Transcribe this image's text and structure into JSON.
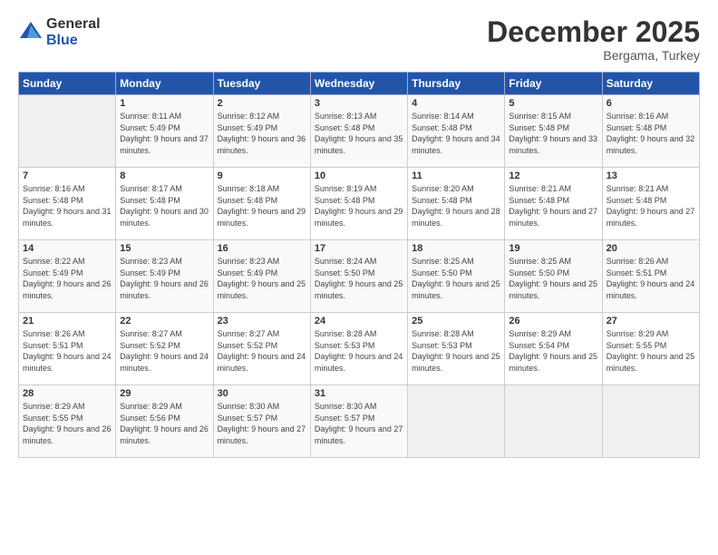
{
  "logo": {
    "general": "General",
    "blue": "Blue"
  },
  "title": "December 2025",
  "subtitle": "Bergama, Turkey",
  "days_header": [
    "Sunday",
    "Monday",
    "Tuesday",
    "Wednesday",
    "Thursday",
    "Friday",
    "Saturday"
  ],
  "weeks": [
    [
      {
        "num": "",
        "empty": true
      },
      {
        "num": "1",
        "sunrise": "Sunrise: 8:11 AM",
        "sunset": "Sunset: 5:49 PM",
        "daylight": "Daylight: 9 hours and 37 minutes."
      },
      {
        "num": "2",
        "sunrise": "Sunrise: 8:12 AM",
        "sunset": "Sunset: 5:49 PM",
        "daylight": "Daylight: 9 hours and 36 minutes."
      },
      {
        "num": "3",
        "sunrise": "Sunrise: 8:13 AM",
        "sunset": "Sunset: 5:48 PM",
        "daylight": "Daylight: 9 hours and 35 minutes."
      },
      {
        "num": "4",
        "sunrise": "Sunrise: 8:14 AM",
        "sunset": "Sunset: 5:48 PM",
        "daylight": "Daylight: 9 hours and 34 minutes."
      },
      {
        "num": "5",
        "sunrise": "Sunrise: 8:15 AM",
        "sunset": "Sunset: 5:48 PM",
        "daylight": "Daylight: 9 hours and 33 minutes."
      },
      {
        "num": "6",
        "sunrise": "Sunrise: 8:16 AM",
        "sunset": "Sunset: 5:48 PM",
        "daylight": "Daylight: 9 hours and 32 minutes."
      }
    ],
    [
      {
        "num": "7",
        "sunrise": "Sunrise: 8:16 AM",
        "sunset": "Sunset: 5:48 PM",
        "daylight": "Daylight: 9 hours and 31 minutes."
      },
      {
        "num": "8",
        "sunrise": "Sunrise: 8:17 AM",
        "sunset": "Sunset: 5:48 PM",
        "daylight": "Daylight: 9 hours and 30 minutes."
      },
      {
        "num": "9",
        "sunrise": "Sunrise: 8:18 AM",
        "sunset": "Sunset: 5:48 PM",
        "daylight": "Daylight: 9 hours and 29 minutes."
      },
      {
        "num": "10",
        "sunrise": "Sunrise: 8:19 AM",
        "sunset": "Sunset: 5:48 PM",
        "daylight": "Daylight: 9 hours and 29 minutes."
      },
      {
        "num": "11",
        "sunrise": "Sunrise: 8:20 AM",
        "sunset": "Sunset: 5:48 PM",
        "daylight": "Daylight: 9 hours and 28 minutes."
      },
      {
        "num": "12",
        "sunrise": "Sunrise: 8:21 AM",
        "sunset": "Sunset: 5:48 PM",
        "daylight": "Daylight: 9 hours and 27 minutes."
      },
      {
        "num": "13",
        "sunrise": "Sunrise: 8:21 AM",
        "sunset": "Sunset: 5:48 PM",
        "daylight": "Daylight: 9 hours and 27 minutes."
      }
    ],
    [
      {
        "num": "14",
        "sunrise": "Sunrise: 8:22 AM",
        "sunset": "Sunset: 5:49 PM",
        "daylight": "Daylight: 9 hours and 26 minutes."
      },
      {
        "num": "15",
        "sunrise": "Sunrise: 8:23 AM",
        "sunset": "Sunset: 5:49 PM",
        "daylight": "Daylight: 9 hours and 26 minutes."
      },
      {
        "num": "16",
        "sunrise": "Sunrise: 8:23 AM",
        "sunset": "Sunset: 5:49 PM",
        "daylight": "Daylight: 9 hours and 25 minutes."
      },
      {
        "num": "17",
        "sunrise": "Sunrise: 8:24 AM",
        "sunset": "Sunset: 5:50 PM",
        "daylight": "Daylight: 9 hours and 25 minutes."
      },
      {
        "num": "18",
        "sunrise": "Sunrise: 8:25 AM",
        "sunset": "Sunset: 5:50 PM",
        "daylight": "Daylight: 9 hours and 25 minutes."
      },
      {
        "num": "19",
        "sunrise": "Sunrise: 8:25 AM",
        "sunset": "Sunset: 5:50 PM",
        "daylight": "Daylight: 9 hours and 25 minutes."
      },
      {
        "num": "20",
        "sunrise": "Sunrise: 8:26 AM",
        "sunset": "Sunset: 5:51 PM",
        "daylight": "Daylight: 9 hours and 24 minutes."
      }
    ],
    [
      {
        "num": "21",
        "sunrise": "Sunrise: 8:26 AM",
        "sunset": "Sunset: 5:51 PM",
        "daylight": "Daylight: 9 hours and 24 minutes."
      },
      {
        "num": "22",
        "sunrise": "Sunrise: 8:27 AM",
        "sunset": "Sunset: 5:52 PM",
        "daylight": "Daylight: 9 hours and 24 minutes."
      },
      {
        "num": "23",
        "sunrise": "Sunrise: 8:27 AM",
        "sunset": "Sunset: 5:52 PM",
        "daylight": "Daylight: 9 hours and 24 minutes."
      },
      {
        "num": "24",
        "sunrise": "Sunrise: 8:28 AM",
        "sunset": "Sunset: 5:53 PM",
        "daylight": "Daylight: 9 hours and 24 minutes."
      },
      {
        "num": "25",
        "sunrise": "Sunrise: 8:28 AM",
        "sunset": "Sunset: 5:53 PM",
        "daylight": "Daylight: 9 hours and 25 minutes."
      },
      {
        "num": "26",
        "sunrise": "Sunrise: 8:29 AM",
        "sunset": "Sunset: 5:54 PM",
        "daylight": "Daylight: 9 hours and 25 minutes."
      },
      {
        "num": "27",
        "sunrise": "Sunrise: 8:29 AM",
        "sunset": "Sunset: 5:55 PM",
        "daylight": "Daylight: 9 hours and 25 minutes."
      }
    ],
    [
      {
        "num": "28",
        "sunrise": "Sunrise: 8:29 AM",
        "sunset": "Sunset: 5:55 PM",
        "daylight": "Daylight: 9 hours and 26 minutes."
      },
      {
        "num": "29",
        "sunrise": "Sunrise: 8:29 AM",
        "sunset": "Sunset: 5:56 PM",
        "daylight": "Daylight: 9 hours and 26 minutes."
      },
      {
        "num": "30",
        "sunrise": "Sunrise: 8:30 AM",
        "sunset": "Sunset: 5:57 PM",
        "daylight": "Daylight: 9 hours and 27 minutes."
      },
      {
        "num": "31",
        "sunrise": "Sunrise: 8:30 AM",
        "sunset": "Sunset: 5:57 PM",
        "daylight": "Daylight: 9 hours and 27 minutes."
      },
      {
        "num": "",
        "empty": true
      },
      {
        "num": "",
        "empty": true
      },
      {
        "num": "",
        "empty": true
      }
    ]
  ]
}
